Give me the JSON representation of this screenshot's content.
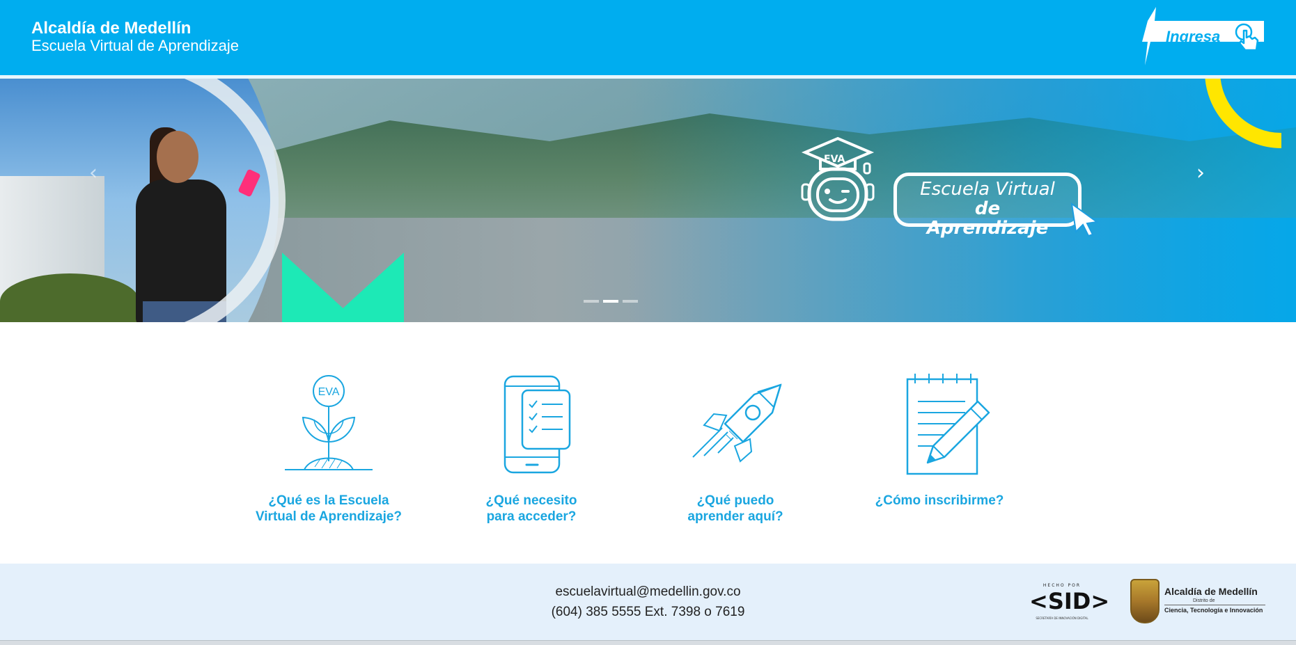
{
  "header": {
    "title": "Alcaldía de Medellín",
    "subtitle": "Escuela Virtual de Aprendizaje",
    "login_label": "Ingresa",
    "colors": {
      "primary": "#00adef",
      "white": "#ffffff"
    }
  },
  "banner": {
    "robot_label": "EVA",
    "logo_line1": "Escuela Virtual",
    "logo_line2": "de Aprendizaje",
    "prev_icon": "chevron-left-icon",
    "next_icon": "chevron-right-icon",
    "slide_count": 2,
    "active_slide": 1,
    "prev_glyph": "‹",
    "next_glyph": "›"
  },
  "features": [
    {
      "icon": "plant-eva-icon",
      "icon_text": "EVA",
      "label": "¿Qué es la Escuela\nVirtual de Aprendizaje?"
    },
    {
      "icon": "phone-checklist-icon",
      "label": "¿Qué necesito\npara acceder?"
    },
    {
      "icon": "rocket-icon",
      "label": "¿Qué puedo\naprender aquí?"
    },
    {
      "icon": "notepad-pencil-icon",
      "label": "¿Cómo inscribirme?"
    }
  ],
  "footer": {
    "email": "escuelavirtual@medellin.gov.co",
    "phone": "(604) 385 5555 Ext. 7398 o 7619",
    "sid_logo": {
      "top": "HECHO POR",
      "main": "<SID>",
      "sub": "SECRETARÍA DE INNOVACIÓN DIGITAL"
    },
    "alcaldia_logo": {
      "title": "Alcaldía de Medellín",
      "district": "Distrito de",
      "tagline": "Ciencia, Tecnología e Innovación"
    },
    "colors": {
      "background": "#e4f0fb",
      "text": "#222222"
    }
  },
  "colors": {
    "accent": "#1aa6e0",
    "yellow": "#ffe600",
    "green": "#1de9b6"
  }
}
